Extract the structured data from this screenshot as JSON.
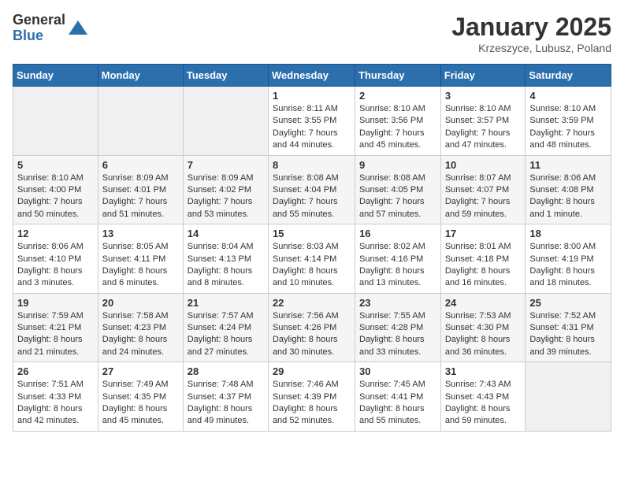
{
  "logo": {
    "general": "General",
    "blue": "Blue"
  },
  "title": "January 2025",
  "subtitle": "Krzeszyce, Lubusz, Poland",
  "days_of_week": [
    "Sunday",
    "Monday",
    "Tuesday",
    "Wednesday",
    "Thursday",
    "Friday",
    "Saturday"
  ],
  "weeks": [
    [
      {
        "day": "",
        "info": ""
      },
      {
        "day": "",
        "info": ""
      },
      {
        "day": "",
        "info": ""
      },
      {
        "day": "1",
        "info": "Sunrise: 8:11 AM\nSunset: 3:55 PM\nDaylight: 7 hours and 44 minutes."
      },
      {
        "day": "2",
        "info": "Sunrise: 8:10 AM\nSunset: 3:56 PM\nDaylight: 7 hours and 45 minutes."
      },
      {
        "day": "3",
        "info": "Sunrise: 8:10 AM\nSunset: 3:57 PM\nDaylight: 7 hours and 47 minutes."
      },
      {
        "day": "4",
        "info": "Sunrise: 8:10 AM\nSunset: 3:59 PM\nDaylight: 7 hours and 48 minutes."
      }
    ],
    [
      {
        "day": "5",
        "info": "Sunrise: 8:10 AM\nSunset: 4:00 PM\nDaylight: 7 hours and 50 minutes."
      },
      {
        "day": "6",
        "info": "Sunrise: 8:09 AM\nSunset: 4:01 PM\nDaylight: 7 hours and 51 minutes."
      },
      {
        "day": "7",
        "info": "Sunrise: 8:09 AM\nSunset: 4:02 PM\nDaylight: 7 hours and 53 minutes."
      },
      {
        "day": "8",
        "info": "Sunrise: 8:08 AM\nSunset: 4:04 PM\nDaylight: 7 hours and 55 minutes."
      },
      {
        "day": "9",
        "info": "Sunrise: 8:08 AM\nSunset: 4:05 PM\nDaylight: 7 hours and 57 minutes."
      },
      {
        "day": "10",
        "info": "Sunrise: 8:07 AM\nSunset: 4:07 PM\nDaylight: 7 hours and 59 minutes."
      },
      {
        "day": "11",
        "info": "Sunrise: 8:06 AM\nSunset: 4:08 PM\nDaylight: 8 hours and 1 minute."
      }
    ],
    [
      {
        "day": "12",
        "info": "Sunrise: 8:06 AM\nSunset: 4:10 PM\nDaylight: 8 hours and 3 minutes."
      },
      {
        "day": "13",
        "info": "Sunrise: 8:05 AM\nSunset: 4:11 PM\nDaylight: 8 hours and 6 minutes."
      },
      {
        "day": "14",
        "info": "Sunrise: 8:04 AM\nSunset: 4:13 PM\nDaylight: 8 hours and 8 minutes."
      },
      {
        "day": "15",
        "info": "Sunrise: 8:03 AM\nSunset: 4:14 PM\nDaylight: 8 hours and 10 minutes."
      },
      {
        "day": "16",
        "info": "Sunrise: 8:02 AM\nSunset: 4:16 PM\nDaylight: 8 hours and 13 minutes."
      },
      {
        "day": "17",
        "info": "Sunrise: 8:01 AM\nSunset: 4:18 PM\nDaylight: 8 hours and 16 minutes."
      },
      {
        "day": "18",
        "info": "Sunrise: 8:00 AM\nSunset: 4:19 PM\nDaylight: 8 hours and 18 minutes."
      }
    ],
    [
      {
        "day": "19",
        "info": "Sunrise: 7:59 AM\nSunset: 4:21 PM\nDaylight: 8 hours and 21 minutes."
      },
      {
        "day": "20",
        "info": "Sunrise: 7:58 AM\nSunset: 4:23 PM\nDaylight: 8 hours and 24 minutes."
      },
      {
        "day": "21",
        "info": "Sunrise: 7:57 AM\nSunset: 4:24 PM\nDaylight: 8 hours and 27 minutes."
      },
      {
        "day": "22",
        "info": "Sunrise: 7:56 AM\nSunset: 4:26 PM\nDaylight: 8 hours and 30 minutes."
      },
      {
        "day": "23",
        "info": "Sunrise: 7:55 AM\nSunset: 4:28 PM\nDaylight: 8 hours and 33 minutes."
      },
      {
        "day": "24",
        "info": "Sunrise: 7:53 AM\nSunset: 4:30 PM\nDaylight: 8 hours and 36 minutes."
      },
      {
        "day": "25",
        "info": "Sunrise: 7:52 AM\nSunset: 4:31 PM\nDaylight: 8 hours and 39 minutes."
      }
    ],
    [
      {
        "day": "26",
        "info": "Sunrise: 7:51 AM\nSunset: 4:33 PM\nDaylight: 8 hours and 42 minutes."
      },
      {
        "day": "27",
        "info": "Sunrise: 7:49 AM\nSunset: 4:35 PM\nDaylight: 8 hours and 45 minutes."
      },
      {
        "day": "28",
        "info": "Sunrise: 7:48 AM\nSunset: 4:37 PM\nDaylight: 8 hours and 49 minutes."
      },
      {
        "day": "29",
        "info": "Sunrise: 7:46 AM\nSunset: 4:39 PM\nDaylight: 8 hours and 52 minutes."
      },
      {
        "day": "30",
        "info": "Sunrise: 7:45 AM\nSunset: 4:41 PM\nDaylight: 8 hours and 55 minutes."
      },
      {
        "day": "31",
        "info": "Sunrise: 7:43 AM\nSunset: 4:43 PM\nDaylight: 8 hours and 59 minutes."
      },
      {
        "day": "",
        "info": ""
      }
    ]
  ]
}
